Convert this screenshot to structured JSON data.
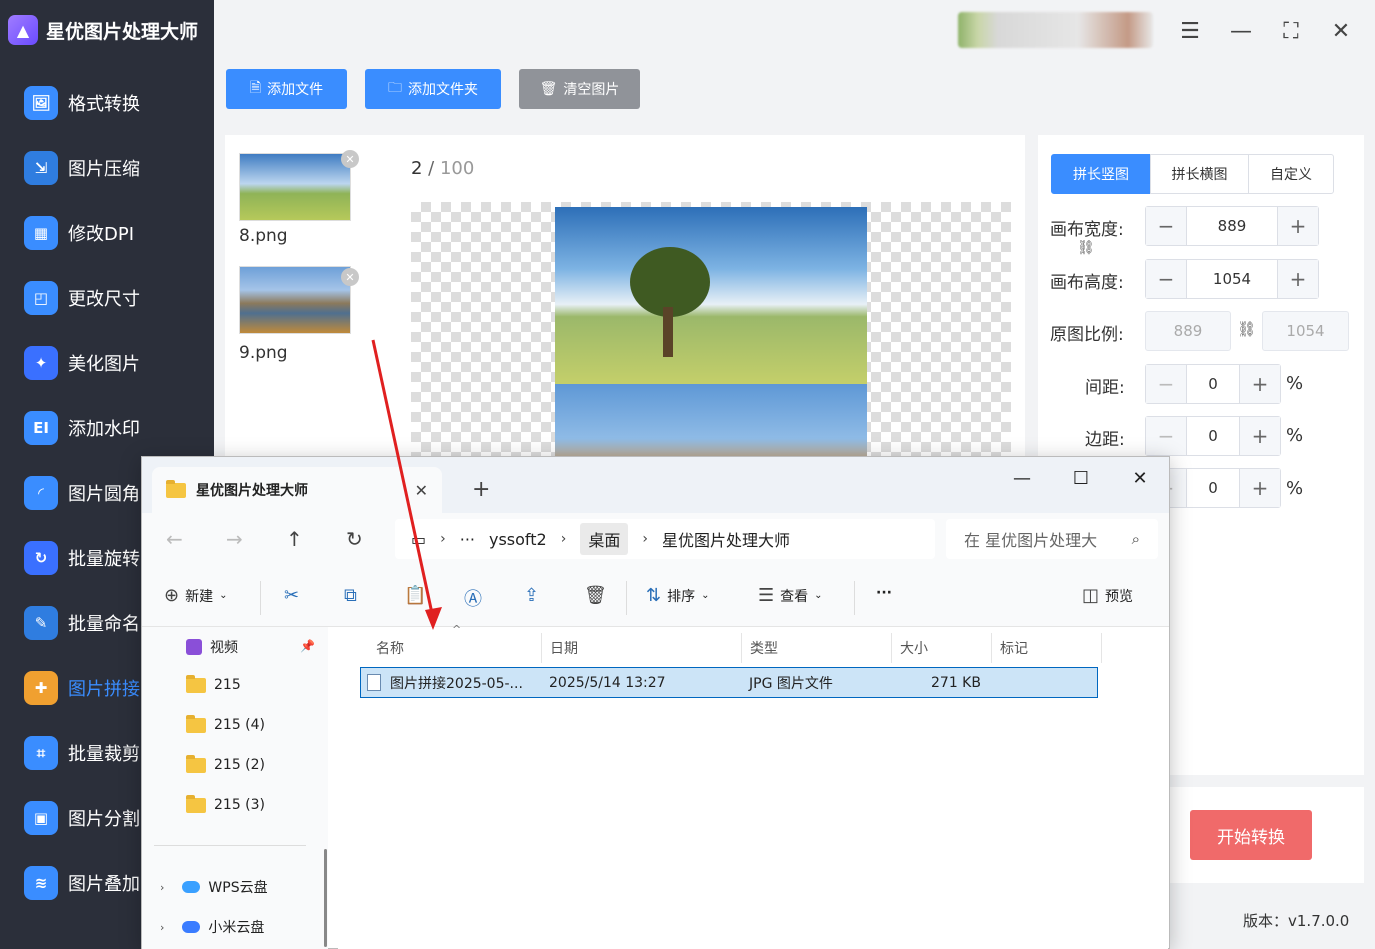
{
  "app": {
    "title": "星优图片处理大师",
    "version": "版本：v1.7.0.0"
  },
  "sidebar": {
    "items": [
      {
        "label": "格式转换",
        "icon": "image-convert-icon",
        "color": "#3a8dff"
      },
      {
        "label": "图片压缩",
        "icon": "compress-icon",
        "color": "#3a8dff"
      },
      {
        "label": "修改DPI",
        "icon": "dpi-icon",
        "color": "#3a8dff"
      },
      {
        "label": "更改尺寸",
        "icon": "resize-icon",
        "color": "#3a8dff"
      },
      {
        "label": "美化图片",
        "icon": "beautify-icon",
        "color": "#3a8dff"
      },
      {
        "label": "添加水印",
        "icon": "watermark-icon",
        "color": "#3a8dff"
      },
      {
        "label": "图片圆角",
        "icon": "round-corner-icon",
        "color": "#3a8dff"
      },
      {
        "label": "批量旋转",
        "icon": "rotate-icon",
        "color": "#3a8dff"
      },
      {
        "label": "批量命名",
        "icon": "rename-icon",
        "color": "#3a8dff"
      },
      {
        "label": "图片拼接",
        "icon": "stitch-icon",
        "color": "#3a8dff",
        "active": true
      },
      {
        "label": "批量裁剪",
        "icon": "crop-icon",
        "color": "#3a8dff"
      },
      {
        "label": "图片分割",
        "icon": "split-icon",
        "color": "#3a8dff"
      },
      {
        "label": "图片叠加",
        "icon": "layers-icon",
        "color": "#3a8dff"
      }
    ]
  },
  "toolbar": {
    "add_file": "添加文件",
    "add_folder": "添加文件夹",
    "clear": "清空图片"
  },
  "files": [
    {
      "name": "8.png"
    },
    {
      "name": "9.png"
    }
  ],
  "preview": {
    "counter_current": "2",
    "counter_sep": " / ",
    "counter_total": "100"
  },
  "settings": {
    "tabs": [
      "拼长竖图",
      "拼长横图",
      "自定义"
    ],
    "canvas_width_label": "画布宽度:",
    "canvas_width": "889",
    "canvas_height_label": "画布高度:",
    "canvas_height": "1054",
    "ratio_label": "原图比例:",
    "ratio_w": "889",
    "ratio_h": "1054",
    "spacing_label": "间距:",
    "spacing": "0",
    "margin_label": "边距:",
    "margin": "0",
    "third_value": "0",
    "percent": "%",
    "start_button": "开始转换"
  },
  "explorer": {
    "tab_title": "星优图片处理大师",
    "breadcrumb": [
      "yssoft2",
      "桌面",
      "星优图片处理大师"
    ],
    "breadcrumb_more": "···",
    "search_placeholder": "在 星优图片处理大",
    "commands": {
      "new": "新建",
      "sort": "排序",
      "view": "查看",
      "more": "···",
      "preview": "预览"
    },
    "tree": [
      "视频",
      "215",
      "215 (4)",
      "215 (2)",
      "215 (3)",
      "WPS云盘",
      "小米云盘"
    ],
    "columns": [
      "名称",
      "日期",
      "类型",
      "大小",
      "标记"
    ],
    "file": {
      "name": "图片拼接2025-05-...",
      "date": "2025/5/14 13:27",
      "type": "JPG 图片文件",
      "size": "271 KB"
    }
  }
}
